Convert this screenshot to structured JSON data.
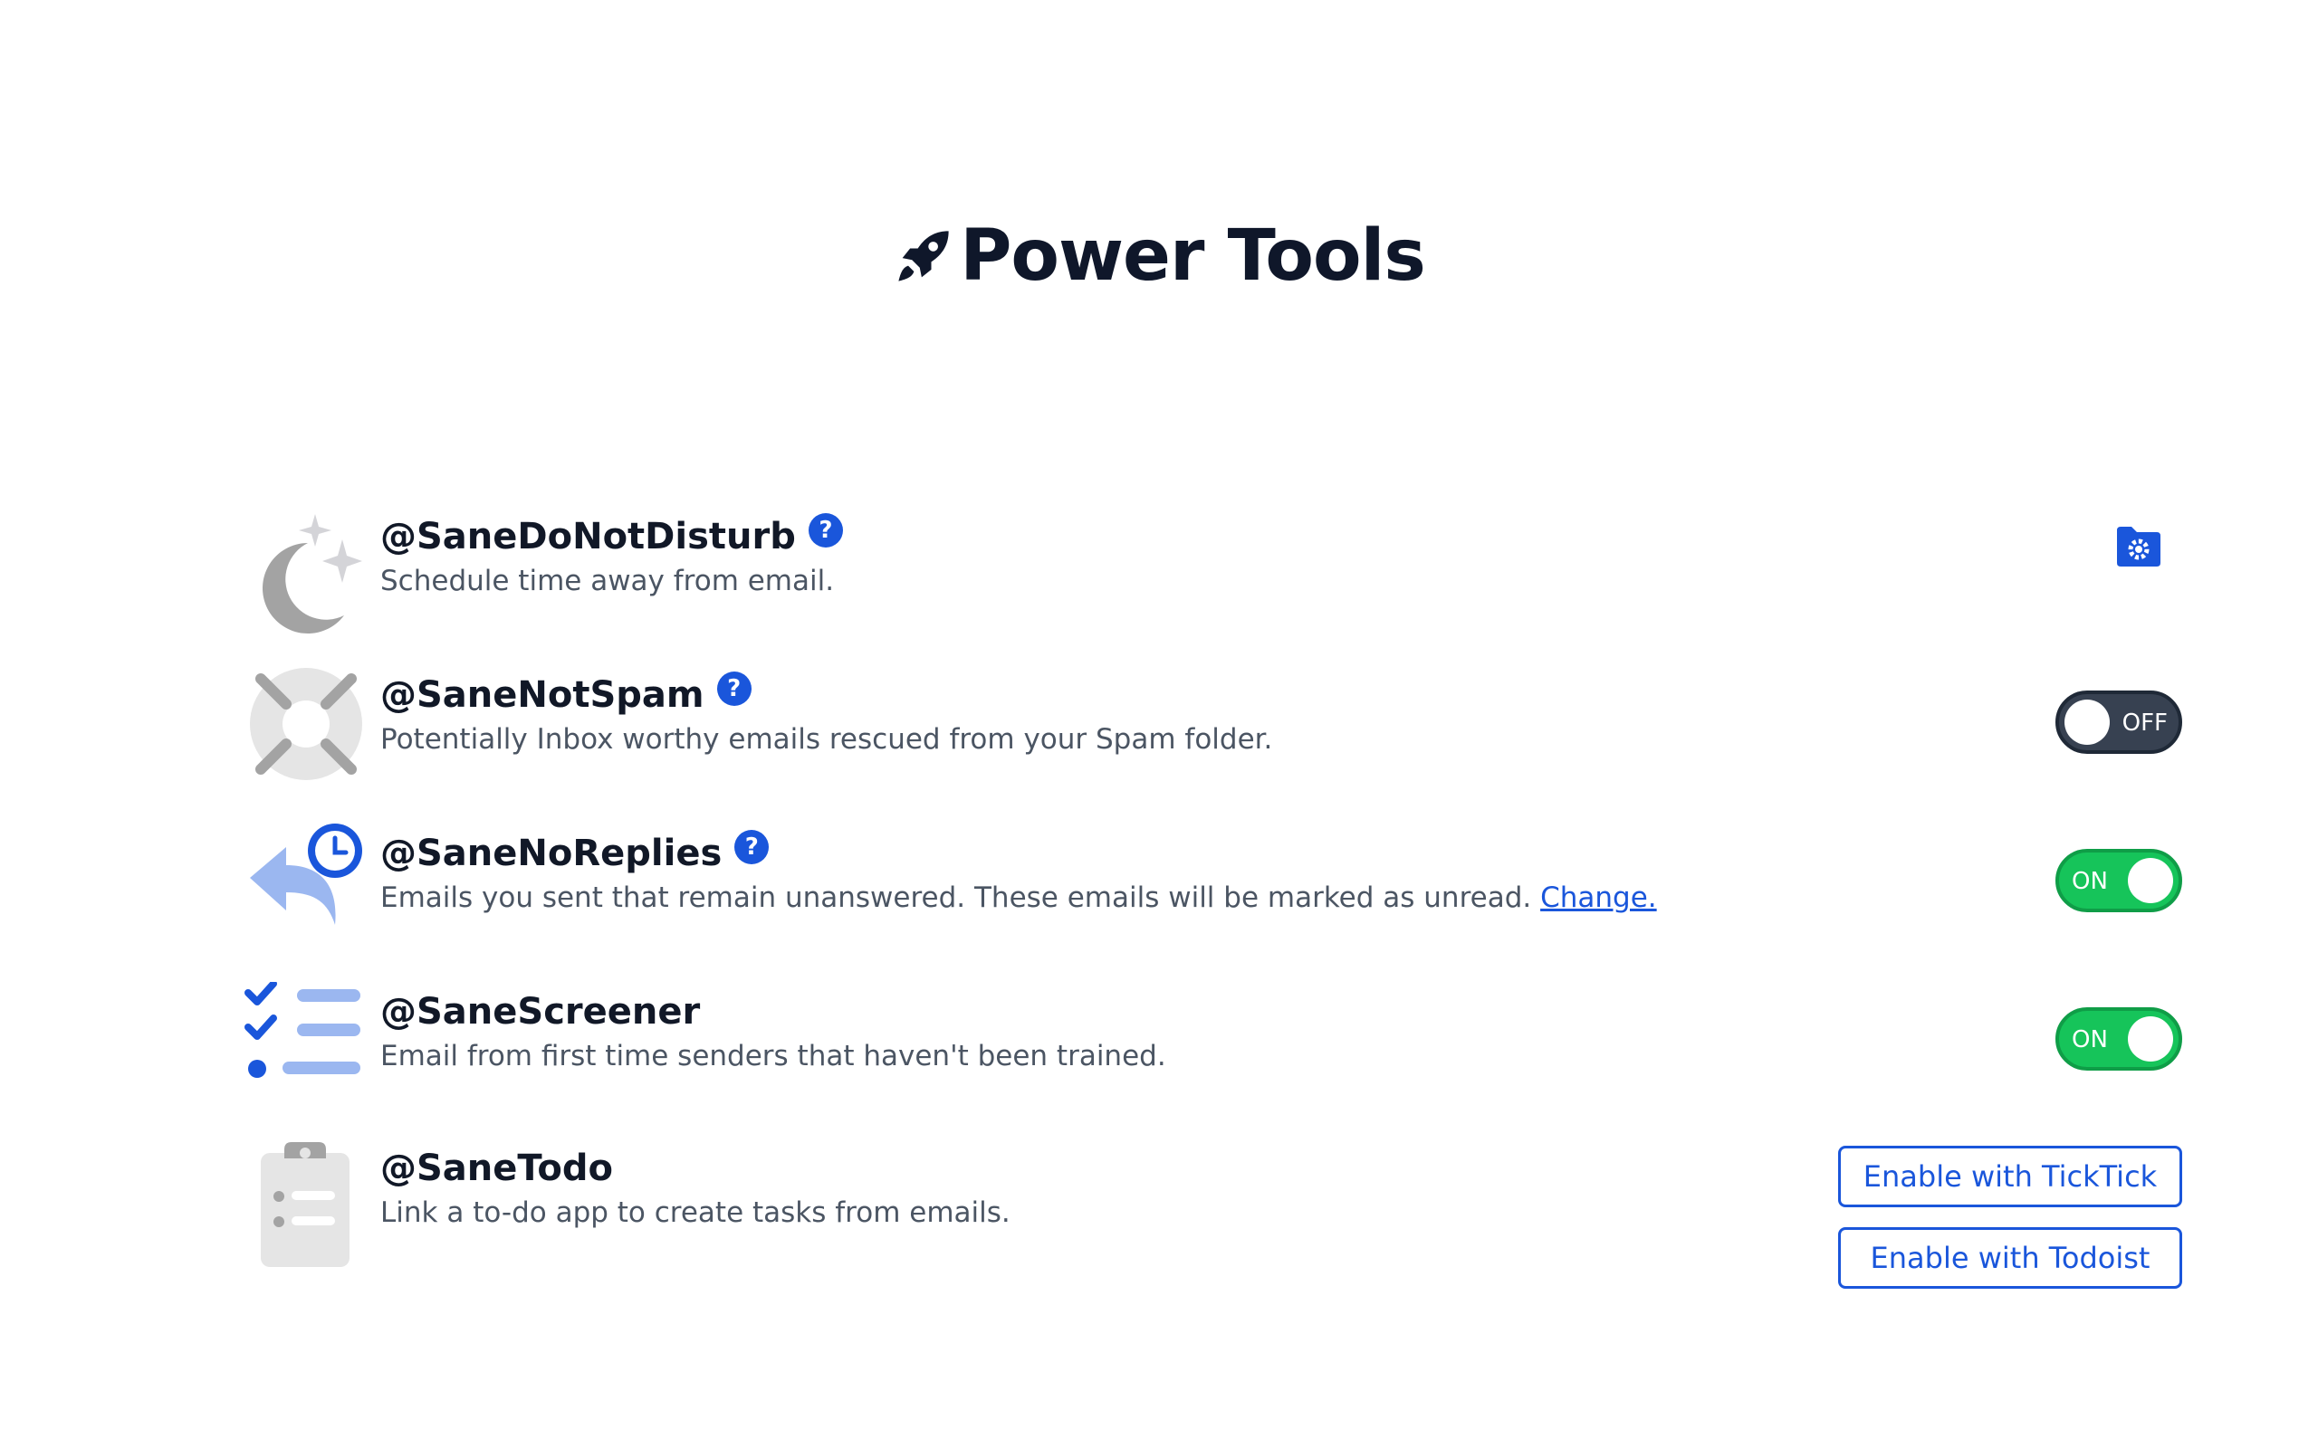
{
  "header": {
    "title": "Power Tools",
    "icon": "rocket-icon"
  },
  "colors": {
    "accent": "#1a56db",
    "on": "#16c45a",
    "off": "#374151",
    "text": "#111827",
    "muted": "#4b5563"
  },
  "tools": [
    {
      "name": "@SaneDoNotDisturb",
      "description": "Schedule time away from email.",
      "icon": "moon-stars-icon",
      "control": "settings",
      "settings_icon": "folder-gear-icon"
    },
    {
      "name": "@SaneNotSpam",
      "description": "Potentially Inbox worthy emails rescued from your Spam folder.",
      "icon": "lifebuoy-icon",
      "control": "toggle",
      "toggle_label": "OFF",
      "state": "off"
    },
    {
      "name": "@SaneNoReplies",
      "description": "Emails you sent that remain unanswered. These emails will be marked as unread.",
      "link": "Change.",
      "icon": "reply-clock-icon",
      "control": "toggle",
      "toggle_label": "ON",
      "state": "on"
    },
    {
      "name": "@SaneScreener",
      "description": "Email from first time senders that haven't been trained.",
      "icon": "checklist-icon",
      "control": "toggle",
      "toggle_label": "ON",
      "state": "on"
    },
    {
      "name": "@SaneTodo",
      "description": "Link a to-do app to create tasks from emails.",
      "icon": "clipboard-icon",
      "buttons": [
        "Enable with TickTick",
        "Enable with Todoist"
      ]
    }
  ],
  "help_icon_glyph": "?"
}
